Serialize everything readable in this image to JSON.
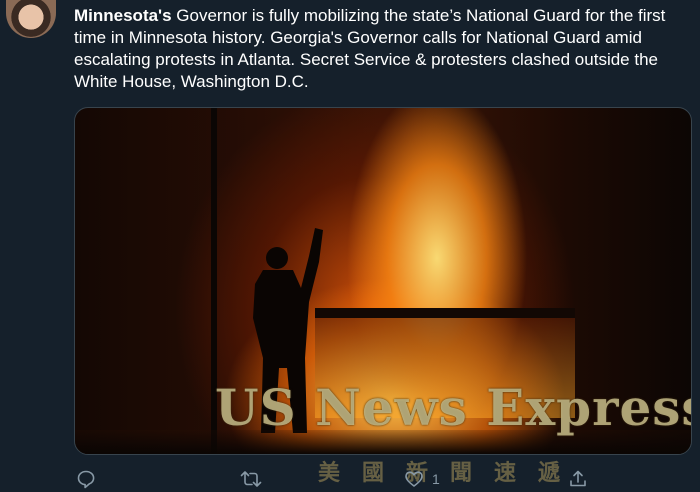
{
  "tweet": {
    "text_bold": "Minnesota's",
    "text_rest": " Governor is fully mobilizing the state’s National Guard for the first time in Minnesota history. Georgia's Governor calls for National Guard amid escalating protests in Atlanta. Secret Service & protesters clashed outside the White House, Washington D.C."
  },
  "media": {
    "watermark": "US News Express",
    "watermark_sub": "美國新聞速遞"
  },
  "actions": {
    "reply_icon": "reply-icon",
    "retweet_icon": "retweet-icon",
    "like_icon": "heart-icon",
    "like_count": "1",
    "share_icon": "share-icon"
  },
  "colors": {
    "background": "#15202b",
    "muted": "#8899a6",
    "text": "#ffffff"
  }
}
